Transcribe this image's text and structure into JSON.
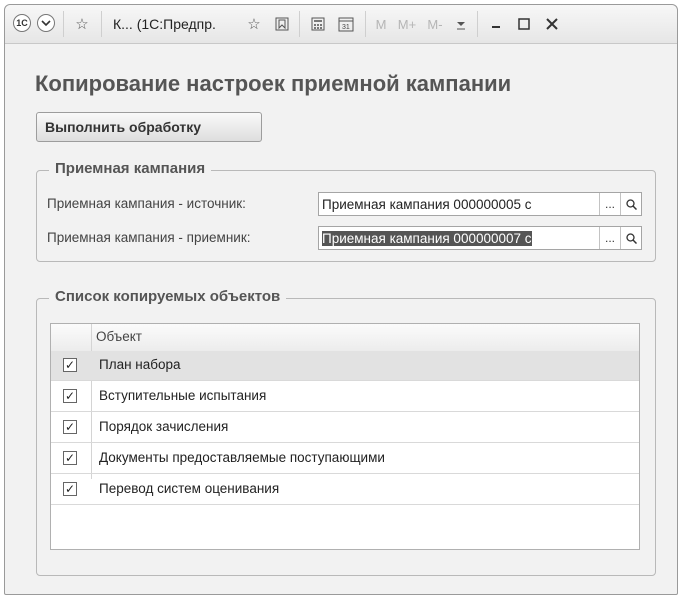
{
  "window": {
    "title": "К... (1С:Предпр.",
    "toolbar_buttons": [
      "M",
      "M+",
      "M-"
    ],
    "app_icon": "1c-logo-icon"
  },
  "page": {
    "title": "Копирование настроек приемной кампании",
    "execute_button": "Выполнить обработку"
  },
  "campaign_group": {
    "legend": "Приемная кампания",
    "source_label": "Приемная кампания - источник:",
    "source_value": "Приемная кампания 000000005 с",
    "target_label": "Приемная кампания - приемник:",
    "target_value": "Приемная кампания 000000007 с",
    "select_button": "...",
    "search_icon": "magnifier-icon"
  },
  "objects_group": {
    "legend": "Список копируемых объектов",
    "column_header": "Объект",
    "rows": [
      {
        "label": "План набора",
        "checked": true
      },
      {
        "label": "Вступительные испытания",
        "checked": true
      },
      {
        "label": "Порядок зачисления",
        "checked": true
      },
      {
        "label": "Документы предоставляемые поступающими",
        "checked": true
      },
      {
        "label": "Перевод систем оценивания",
        "checked": true
      }
    ]
  }
}
